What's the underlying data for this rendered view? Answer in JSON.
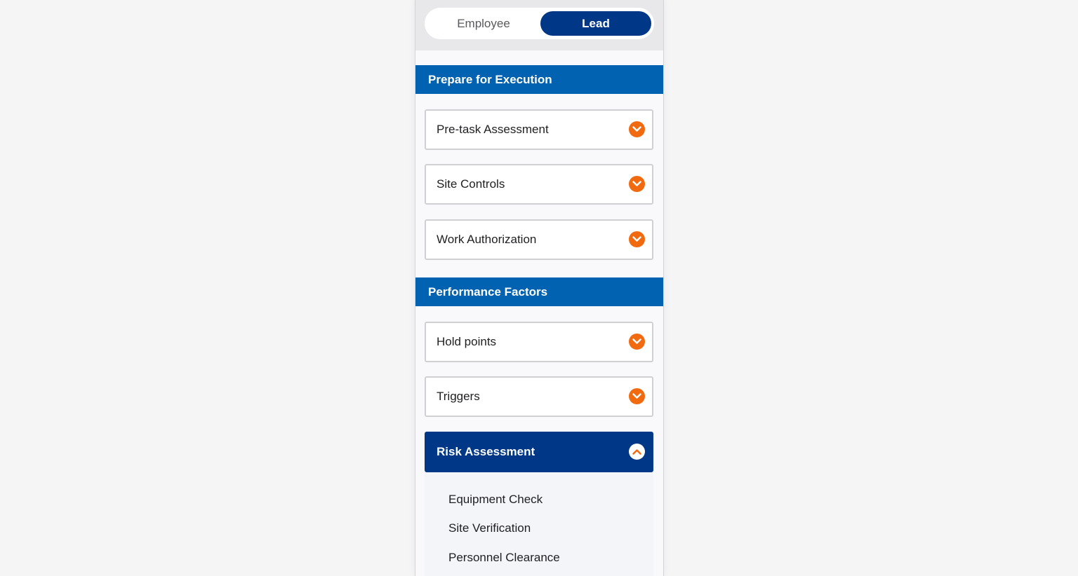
{
  "toggle": {
    "employee_label": "Employee",
    "lead_label": "Lead",
    "selected": "Lead"
  },
  "sections": [
    {
      "title": "Prepare for Execution",
      "items": [
        {
          "label": "Pre-task Assessment",
          "expanded": false
        },
        {
          "label": "Site Controls",
          "expanded": false
        },
        {
          "label": "Work Authorization",
          "expanded": false
        }
      ]
    },
    {
      "title": "Performance Factors",
      "items": [
        {
          "label": "Hold points",
          "expanded": false
        },
        {
          "label": "Triggers",
          "expanded": false
        },
        {
          "label": "Risk Assessment",
          "expanded": true,
          "children": [
            "Equipment Check",
            "Site Verification",
            "Personnel Clearance"
          ]
        }
      ]
    }
  ],
  "icons": {
    "collapsed": "chevron-down-icon",
    "expanded": "chevron-up-icon"
  },
  "colors": {
    "primary_navy": "#003786",
    "section_blue": "#0062b1",
    "accent_orange": "#f26a10"
  }
}
